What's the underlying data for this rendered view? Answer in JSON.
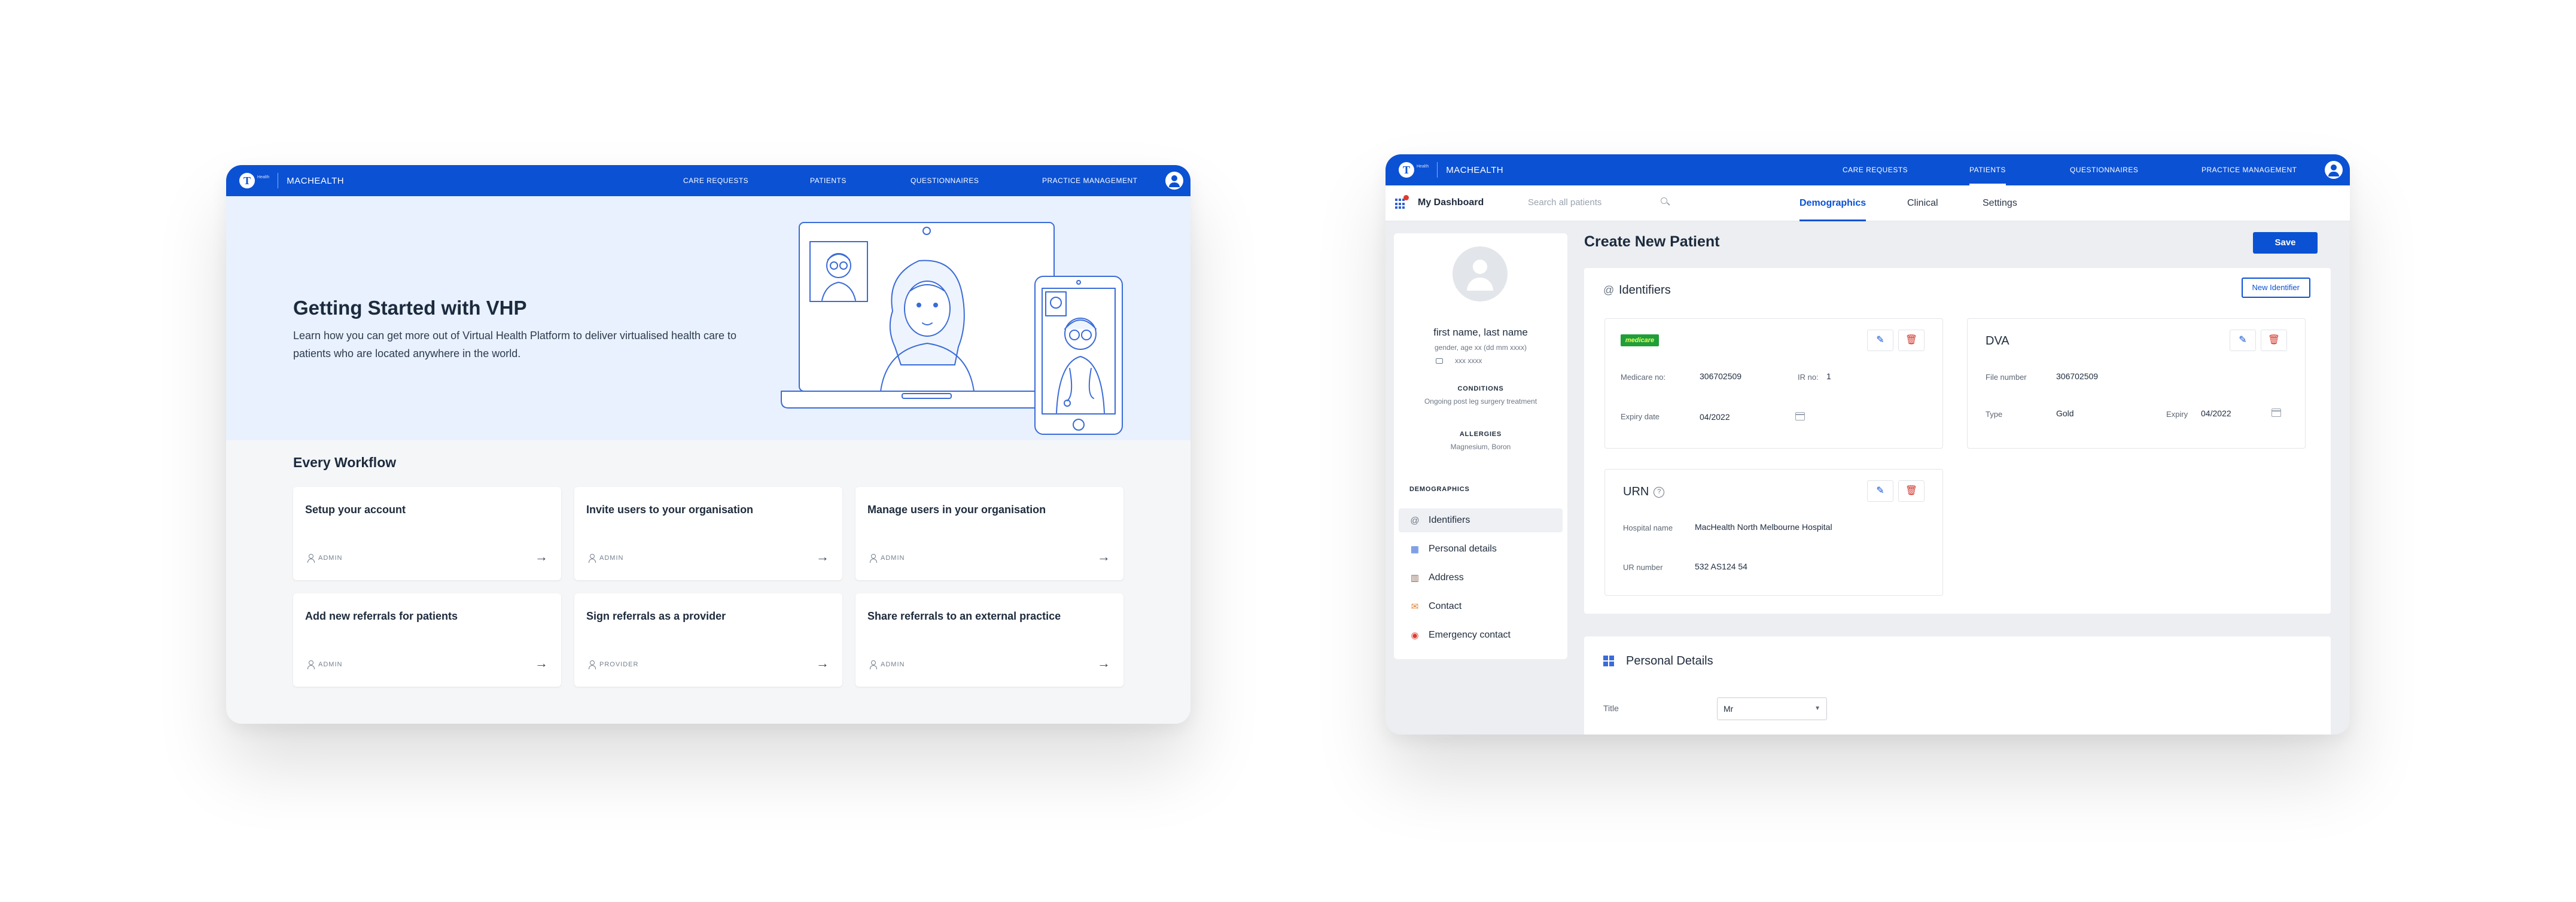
{
  "brand": {
    "name": "MACHEALTH",
    "small": "Health"
  },
  "colors": {
    "primary": "#0b51d3",
    "hero_bg": "#e8f1fd",
    "danger": "#d3352b",
    "medicare": "#1f9e3a"
  },
  "window1": {
    "nav": [
      "CARE REQUESTS",
      "PATIENTS",
      "QUESTIONNAIRES",
      "PRACTICE MANAGEMENT"
    ],
    "hero": {
      "title": "Getting Started with VHP",
      "text": "Learn how you can get more out of Virtual Health Platform to deliver virtualised health care to patients who are located anywhere in the world."
    },
    "section_title": "Every Workflow",
    "cards": [
      {
        "title": "Setup your account",
        "role": "ADMIN"
      },
      {
        "title": "Invite users to your organisation",
        "role": "ADMIN"
      },
      {
        "title": "Manage users in your organisation",
        "role": "ADMIN"
      },
      {
        "title": "Add new referrals for patients",
        "role": "ADMIN"
      },
      {
        "title": "Sign referrals as a provider",
        "role": "PROVIDER"
      },
      {
        "title": "Share referrals to an external practice",
        "role": "ADMIN"
      }
    ]
  },
  "window2": {
    "nav": [
      "CARE REQUESTS",
      "PATIENTS",
      "QUESTIONNAIRES",
      "PRACTICE MANAGEMENT"
    ],
    "active_nav": "PATIENTS",
    "dashboard": "My Dashboard",
    "search_placeholder": "Search all patients",
    "tabs": [
      "Demographics",
      "Clinical",
      "Settings"
    ],
    "patient": {
      "name": "first name, last name",
      "meta": "gender, age xx (dd mm xxxx)",
      "id": "xxx xxxx",
      "conditions_label": "CONDITIONS",
      "conditions": "Ongoing post leg surgery treatment",
      "allergies_label": "ALLERGIES",
      "allergies": "Magnesium, Boron"
    },
    "demographics_label": "DEMOGRAPHICS",
    "side_nav": [
      {
        "label": "Identifiers",
        "icon": "at-icon"
      },
      {
        "label": "Personal details",
        "icon": "grid-icon"
      },
      {
        "label": "Address",
        "icon": "building-icon"
      },
      {
        "label": "Contact",
        "icon": "mail-icon"
      },
      {
        "label": "Emergency contact",
        "icon": "emergency-icon"
      }
    ],
    "page_title": "Create New Patient",
    "save": "Save",
    "identifiers": {
      "title": "Identifiers",
      "new_button": "New Identifier",
      "medicare": {
        "badge": "medicare",
        "number_label": "Medicare no:",
        "number": "306702509",
        "irn_label": "IR no:",
        "irn": "1",
        "expiry_label": "Expiry date",
        "expiry": "04/2022"
      },
      "dva": {
        "title": "DVA",
        "file_label": "File number",
        "file": "306702509",
        "type_label": "Type",
        "type": "Gold",
        "expiry_label": "Expiry",
        "expiry": "04/2022"
      },
      "urn": {
        "title": "URN",
        "hospital_label": "Hospital name",
        "hospital": "MacHealth North Melbourne Hospital",
        "ur_label": "UR number",
        "ur": "532 AS124 54"
      }
    },
    "personal": {
      "title": "Personal Details",
      "title_label": "Title",
      "title_value": "Mr"
    }
  }
}
